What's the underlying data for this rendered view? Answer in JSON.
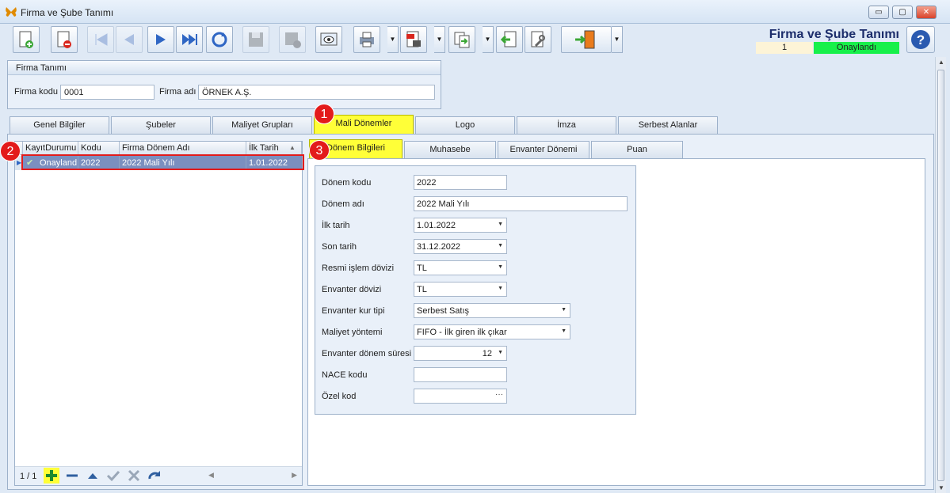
{
  "window": {
    "title": "Firma ve Şube Tanımı"
  },
  "header": {
    "app_title": "Firma ve Şube Tanımı",
    "record_no": "1",
    "status": "Onaylandı"
  },
  "firm": {
    "group_title": "Firma Tanımı",
    "code_label": "Firma kodu",
    "code_value": "0001",
    "name_label": "Firma adı",
    "name_value": "ÖRNEK A.Ş."
  },
  "tabs": [
    "Genel Bilgiler",
    "Şubeler",
    "Maliyet Grupları",
    "Mali Dönemler",
    "Logo",
    "İmza",
    "Serbest Alanlar"
  ],
  "grid": {
    "headers": [
      "KayıtDurumu",
      "Kodu",
      "Firma Dönem Adı",
      "İlk Tarih"
    ],
    "rows": [
      {
        "status": "Onayland",
        "code": "2022",
        "name": "2022 Mali Yılı",
        "start": "1.01.2022"
      }
    ],
    "pager": "1 / 1"
  },
  "subtabs": [
    "Dönem Bilgileri",
    "Muhasebe",
    "Envanter Dönemi",
    "Puan"
  ],
  "form": {
    "period_code_label": "Dönem kodu",
    "period_code": "2022",
    "period_name_label": "Dönem adı",
    "period_name": "2022 Mali Yılı",
    "start_label": "İlk tarih",
    "start": "1.01.2022",
    "end_label": "Son tarih",
    "end": "31.12.2022",
    "official_currency_label": "Resmi işlem dövizi",
    "official_currency": "TL",
    "inventory_currency_label": "Envanter dövizi",
    "inventory_currency": "TL",
    "rate_type_label": "Envanter kur tipi",
    "rate_type": "Serbest Satış",
    "cost_method_label": "Maliyet yöntemi",
    "cost_method": "FIFO - İlk giren ilk çıkar",
    "inventory_period_label": "Envanter dönem süresi",
    "inventory_period": "12",
    "nace_label": "NACE kodu",
    "nace": "",
    "special_code_label": "Özel kod",
    "special_code": "",
    "ellipsis": "···"
  },
  "badges": [
    "1",
    "2",
    "3"
  ],
  "window_controls": {
    "minimize": "▭",
    "maximize": "▢",
    "close": "✕"
  }
}
